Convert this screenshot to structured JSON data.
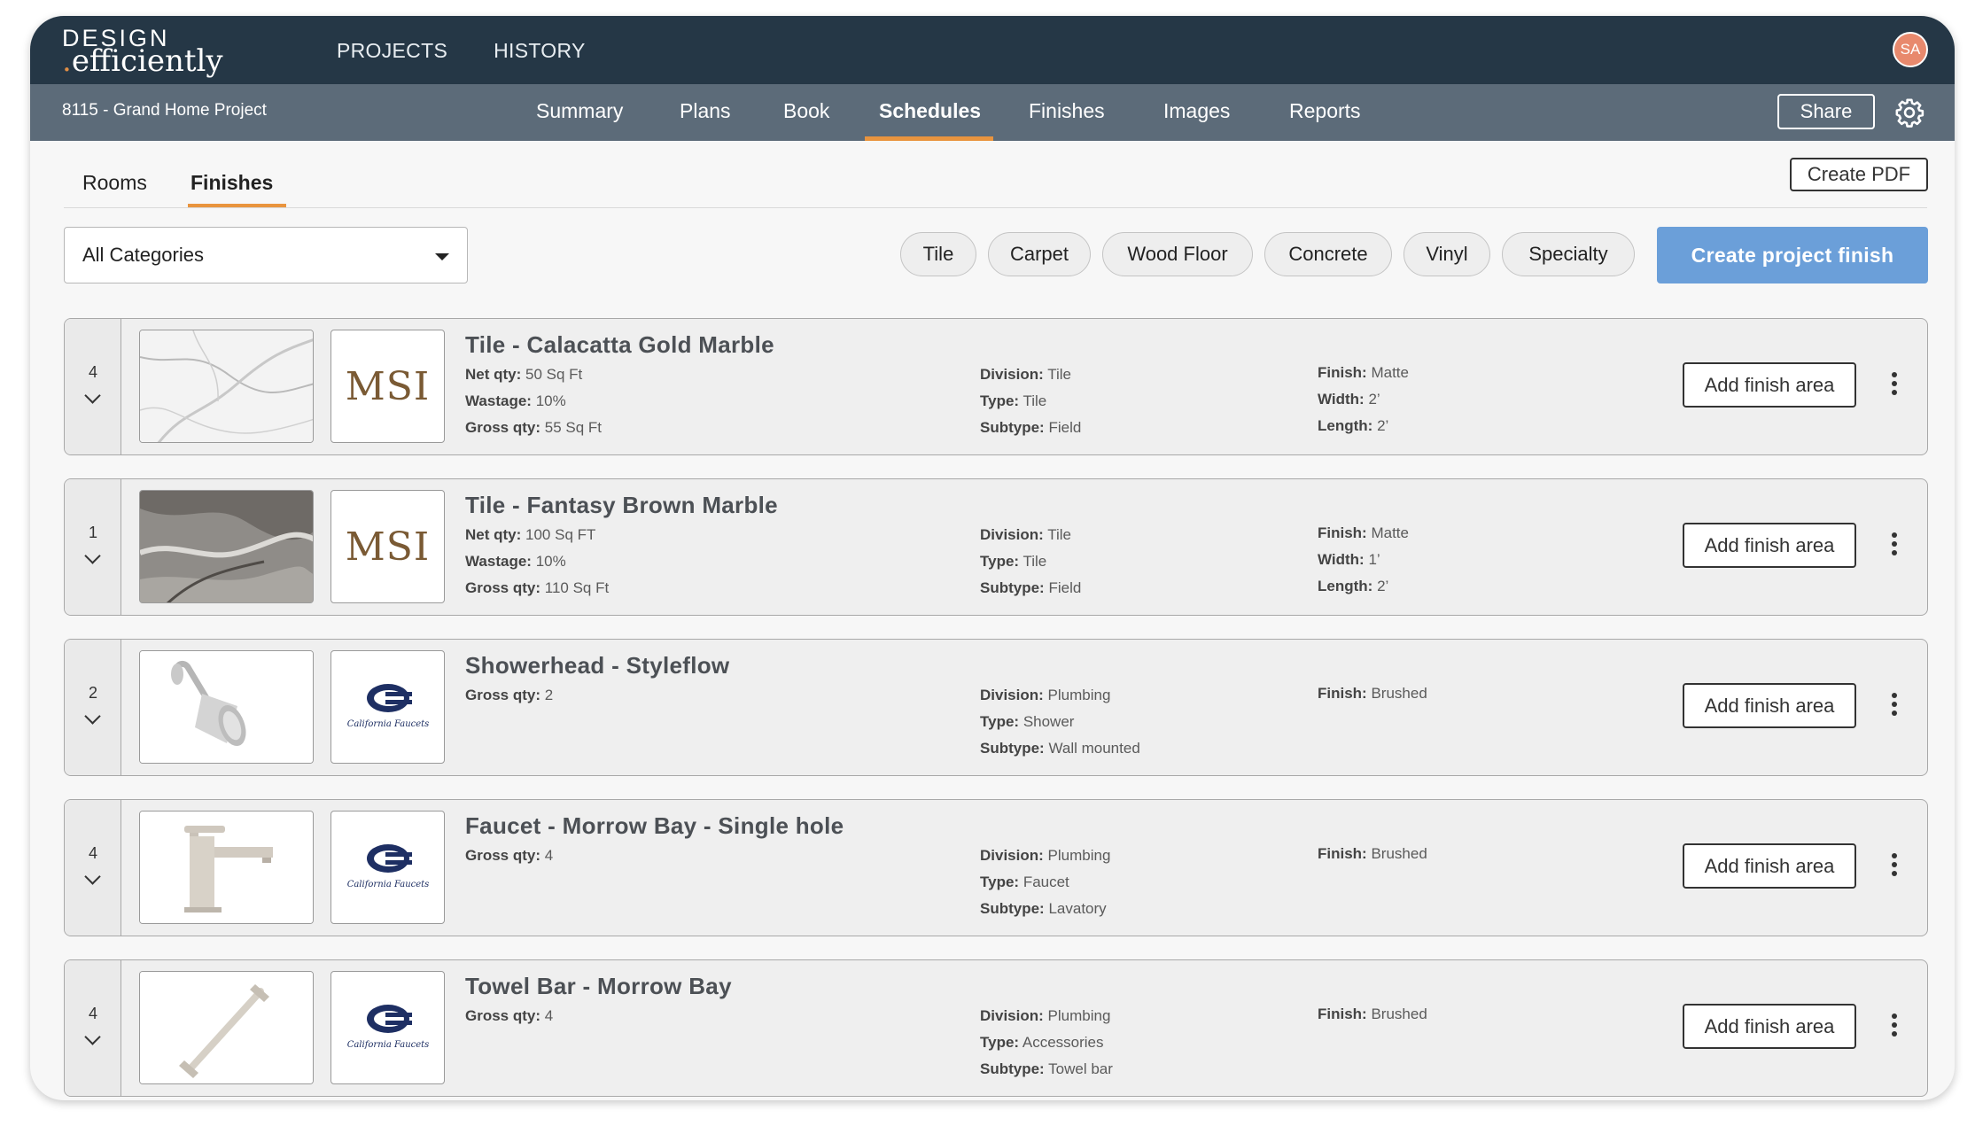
{
  "app": {
    "logo_top": "DESIGN",
    "logo_bottom_dot": ".",
    "logo_bottom": "efficiently",
    "nav": [
      "PROJECTS",
      "HISTORY"
    ],
    "user_initials": "SA"
  },
  "project": {
    "title": "8115 -  Grand Home Project",
    "tabs": [
      "Summary",
      "Plans",
      "Book",
      "Schedules",
      "Finishes",
      "Images",
      "Reports"
    ],
    "active_tab": "Schedules",
    "share_label": "Share"
  },
  "subtabs": [
    "Rooms",
    "Finishes"
  ],
  "active_subtab": "Finishes",
  "create_pdf_label": "Create PDF",
  "filters": {
    "category_select": "All Categories",
    "chips": [
      "Tile",
      "Carpet",
      "Wood Floor",
      "Concrete",
      "Vinyl",
      "Specialty"
    ],
    "create_label": "Create project finish"
  },
  "add_finish_label": "Add finish area",
  "labels": {
    "net_qty": "Net qty:",
    "wastage": "Wastage:",
    "gross_qty": "Gross qty:",
    "division": "Division:",
    "type": "Type:",
    "subtype": "Subtype:",
    "finish": "Finish:",
    "width": "Width:",
    "length": "Length:"
  },
  "finishes": [
    {
      "count": "4",
      "name": "Tile - Calacatta Gold Marble",
      "brand": "MSI",
      "net_qty": "50 Sq Ft",
      "wastage": "10%",
      "gross_qty": "55 Sq Ft",
      "division": "Tile",
      "type": "Tile",
      "subtype": "Field",
      "finish": "Matte",
      "width": "2’",
      "length": "2’"
    },
    {
      "count": "1",
      "name": "Tile - Fantasy Brown Marble",
      "brand": "MSI",
      "net_qty": "100 Sq FT",
      "wastage": "10%",
      "gross_qty": "110 Sq Ft",
      "division": "Tile",
      "type": "Tile",
      "subtype": "Field",
      "finish": "Matte",
      "width": "1’",
      "length": "2’"
    },
    {
      "count": "2",
      "name": "Showerhead - Styleflow",
      "brand": "California Faucets",
      "gross_qty": "2",
      "division": "Plumbing",
      "type": "Shower",
      "subtype": "Wall mounted",
      "finish": "Brushed"
    },
    {
      "count": "4",
      "name": "Faucet - Morrow Bay - Single hole",
      "brand": "California Faucets",
      "gross_qty": "4",
      "division": "Plumbing",
      "type": "Faucet",
      "subtype": "Lavatory",
      "finish": "Brushed"
    },
    {
      "count": "4",
      "name": "Towel Bar - Morrow Bay",
      "brand": "California Faucets",
      "gross_qty": "4",
      "division": "Plumbing",
      "type": "Accessories",
      "subtype": "Towel bar",
      "finish": "Brushed"
    }
  ],
  "colors": {
    "topbar": "#253746",
    "projbar": "#5c6b79",
    "accent": "#e9943e",
    "primary_button": "#6b9fd9"
  }
}
